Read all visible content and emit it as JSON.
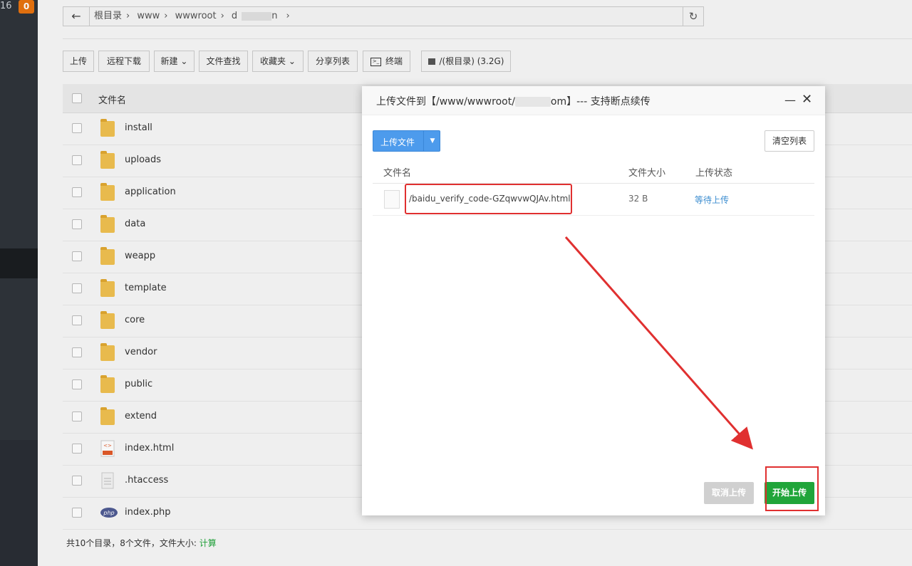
{
  "sidebar": {
    "count": "16",
    "badge": "0"
  },
  "pathbar": {
    "crumbs": [
      "根目录",
      "www",
      "wwwroot",
      "d"
    ],
    "crumb_suffix": "n"
  },
  "toolbar": {
    "upload": "上传",
    "remote_download": "远程下载",
    "new": "新建",
    "file_search": "文件查找",
    "favorites": "收藏夹",
    "share_list": "分享列表",
    "terminal": "终端",
    "disk": "/(根目录) (3.2G)"
  },
  "file_list": {
    "header_name": "文件名",
    "rows": [
      {
        "name": "install",
        "type": "folder"
      },
      {
        "name": "uploads",
        "type": "folder"
      },
      {
        "name": "application",
        "type": "folder"
      },
      {
        "name": "data",
        "type": "folder"
      },
      {
        "name": "weapp",
        "type": "folder"
      },
      {
        "name": "template",
        "type": "folder"
      },
      {
        "name": "core",
        "type": "folder"
      },
      {
        "name": "vendor",
        "type": "folder"
      },
      {
        "name": "public",
        "type": "folder"
      },
      {
        "name": "extend",
        "type": "folder"
      },
      {
        "name": "index.html",
        "type": "html"
      },
      {
        "name": ".htaccess",
        "type": "file"
      },
      {
        "name": "index.php",
        "type": "php"
      }
    ]
  },
  "footer": {
    "summary": "共10个目录，8个文件，文件大小:",
    "calc_link": "计算"
  },
  "dialog": {
    "title_prefix": "上传文件到【/www/wwwroot/",
    "title_suffix": "om】--- 支持断点续传",
    "upload_file_button": "上传文件",
    "clear_list_button": "清空列表",
    "columns": {
      "name": "文件名",
      "size": "文件大小",
      "status": "上传状态"
    },
    "files": [
      {
        "path": "/baidu_verify_code-GZqwvwQJAv.html",
        "size": "32 B",
        "status": "等待上传"
      }
    ],
    "cancel_button": "取消上传",
    "start_button": "开始上传"
  }
}
